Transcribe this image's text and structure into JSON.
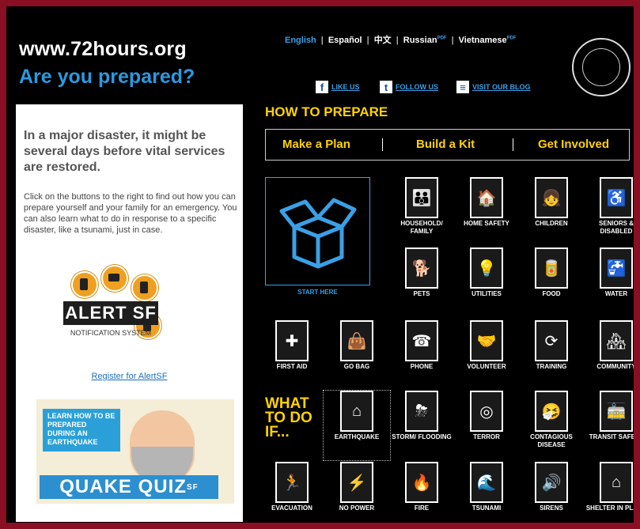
{
  "header": {
    "site_url": "www.72hours.org",
    "tagline": "Are you prepared?"
  },
  "languages": [
    {
      "label": "English",
      "active": true
    },
    {
      "label": "Español"
    },
    {
      "label": "中文"
    },
    {
      "label": "Russian",
      "badge": "PDF"
    },
    {
      "label": "Vietnamese",
      "badge": "PDF"
    }
  ],
  "social": [
    {
      "icon": "facebook-icon",
      "glyph": "f",
      "label": "LIKE US"
    },
    {
      "icon": "twitter-icon",
      "glyph": "t",
      "label": "FOLLOW US"
    },
    {
      "icon": "rss-icon",
      "glyph": "≡",
      "label": "VISIT OUR BLOG"
    }
  ],
  "left_panel": {
    "lead": "In a major disaster, it might be several days before vital services are restored.",
    "intro": "Click on the buttons to the right to find out how you can prepare yourself and your family for an emergency. You can also learn what to do in response to a specific disaster, like a tsunami, just in case.",
    "alert_name": "ALERT SF",
    "alert_sub": "NOTIFICATION SYSTEM",
    "register_link": "Register for AlertSF",
    "quiz_bubble": "LEARN HOW TO BE PREPARED DURING AN EARTHQUAKE",
    "quiz_title": "QUAKE QUIZ",
    "quiz_suffix": "SF"
  },
  "prepare": {
    "heading": "HOW TO PREPARE",
    "links": [
      "Make a Plan",
      "Build a Kit",
      "Get Involved"
    ],
    "start_label": "START HERE"
  },
  "what_to_do": {
    "heading": [
      "WHAT",
      "TO DO",
      "IF..."
    ]
  },
  "colors": {
    "frame": "#8a0f22",
    "accent_yellow": "#ffd200",
    "accent_blue": "#3aa0e6"
  },
  "tiles": [
    {
      "label": "HOUSEHOLD/ FAMILY",
      "icon": "family-icon",
      "glyph": "👪"
    },
    {
      "label": "HOME SAFETY",
      "icon": "house-icon",
      "glyph": "🏠"
    },
    {
      "label": "CHILDREN",
      "icon": "children-icon",
      "glyph": "👧"
    },
    {
      "label": "SENIORS & DISABLED",
      "icon": "wheelchair-icon",
      "glyph": "♿"
    },
    {
      "label": "PETS",
      "icon": "dog-icon",
      "glyph": "🐕"
    },
    {
      "label": "UTILITIES",
      "icon": "lightbulb-icon",
      "glyph": "💡"
    },
    {
      "label": "FOOD",
      "icon": "can-icon",
      "glyph": "🥫"
    },
    {
      "label": "WATER",
      "icon": "faucet-icon",
      "glyph": "🚰"
    },
    {
      "label": "FIRST AID",
      "icon": "first-aid-icon",
      "glyph": "✚"
    },
    {
      "label": "GO BAG",
      "icon": "bag-icon",
      "glyph": "👜"
    },
    {
      "label": "PHONE",
      "icon": "phone-icon",
      "glyph": "☎"
    },
    {
      "label": "VOLUNTEER",
      "icon": "handshake-icon",
      "glyph": "🤝"
    },
    {
      "label": "TRAINING",
      "icon": "training-icon",
      "glyph": "⟳"
    },
    {
      "label": "COMMUNITY",
      "icon": "community-icon",
      "glyph": "🏘"
    },
    {
      "label": "EARTHQUAKE",
      "icon": "earthquake-icon",
      "glyph": "⌂"
    },
    {
      "label": "STORM/ FLOODING",
      "icon": "storm-icon",
      "glyph": "⛈"
    },
    {
      "label": "TERROR",
      "icon": "target-icon",
      "glyph": "◎"
    },
    {
      "label": "CONTAGIOUS DISEASE",
      "icon": "disease-icon",
      "glyph": "🤧"
    },
    {
      "label": "TRANSIT SAFETY",
      "icon": "transit-icon",
      "glyph": "🚋"
    },
    {
      "label": "EVACUATION",
      "icon": "running-person-icon",
      "glyph": "🏃"
    },
    {
      "label": "NO POWER",
      "icon": "no-power-icon",
      "glyph": "⚡"
    },
    {
      "label": "FIRE",
      "icon": "fire-icon",
      "glyph": "🔥"
    },
    {
      "label": "TSUNAMI",
      "icon": "wave-icon",
      "glyph": "🌊"
    },
    {
      "label": "SIRENS",
      "icon": "speaker-icon",
      "glyph": "🔊"
    },
    {
      "label": "SHELTER IN PLACE",
      "icon": "shelter-icon",
      "glyph": "⌂"
    }
  ]
}
